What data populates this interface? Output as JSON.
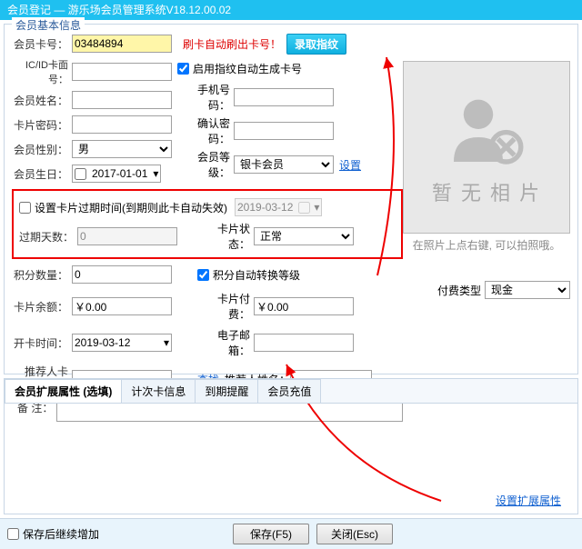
{
  "window": {
    "title": "会员登记 — 游乐场会员管理系统V18.12.00.02"
  },
  "group": {
    "title": "会员基本信息"
  },
  "labels": {
    "card_no": "会员卡号：",
    "ic_card": "IC/ID卡面号：",
    "name": "会员姓名：",
    "card_pwd": "卡片密码：",
    "gender": "会员性别：",
    "birthday": "会员生日：",
    "expire_set": "设置卡片过期时间(到期则此卡自动失效)",
    "expire_days": "过期天数：",
    "card_state": "卡片状态：",
    "points": "积分数量：",
    "balance": "卡片余额：",
    "card_fee": "卡片付费：",
    "open_time": "开卡时间：",
    "email": "电子邮箱：",
    "ref_card": "推荐人卡号：",
    "ref_name": "推荐人姓名：",
    "remark": "备  注：",
    "swipe_note": "刷卡自动刷出卡号！",
    "auto_gen": "启用指纹自动生成卡号",
    "phone": "手机号码：",
    "confirm_pwd": "确认密码：",
    "grade": "会员等级：",
    "auto_upgrade": "积分自动转换等级",
    "pay_type": "付费类型",
    "photo_none": "暂 无 相 片",
    "photo_tip": "在照片上点右键, 可以拍照哦。"
  },
  "values": {
    "card_no": "03484894",
    "gender": "男",
    "grade": "银卡会员",
    "birthday": "2017-01-01",
    "expire_date": "2019-03-12",
    "expire_days": "0",
    "card_state": "正常",
    "points": "0",
    "balance": "￥0.00",
    "card_fee": "￥0.00",
    "open_time": "2019-03-12",
    "pay_type": "现金"
  },
  "buttons": {
    "fingerprint": "录取指纹",
    "lookup": "查找",
    "grade_setting": "设置",
    "ext_setting": "设置扩展属性",
    "save": "保存(F5)",
    "close": "关闭(Esc)",
    "keep_add": "保存后继续增加"
  },
  "tabs": {
    "ext": "会员扩展属性 (选填)",
    "card_info": "计次卡信息",
    "expire_remind": "到期提醒",
    "recharge": "会员充值"
  }
}
